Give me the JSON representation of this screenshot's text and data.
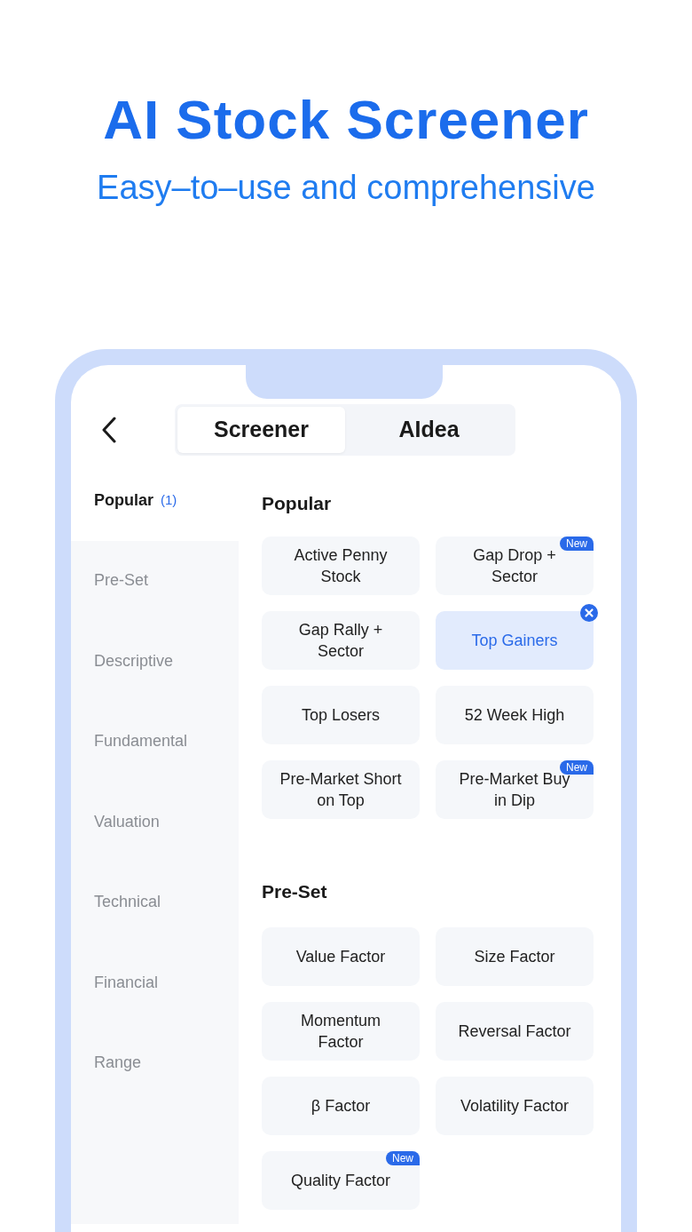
{
  "headline": {
    "title": "AI Stock Screener",
    "subtitle": "Easy–to–use and comprehensive"
  },
  "tabs": [
    {
      "label": "Screener",
      "selected": true
    },
    {
      "label": "AIdea",
      "selected": false
    }
  ],
  "sidebar": {
    "items": [
      {
        "label": "Popular",
        "count": "(1)",
        "selected": true
      },
      {
        "label": "Pre-Set",
        "selected": false
      },
      {
        "label": "Descriptive",
        "selected": false
      },
      {
        "label": "Fundamental",
        "selected": false
      },
      {
        "label": "Valuation",
        "selected": false
      },
      {
        "label": "Technical",
        "selected": false
      },
      {
        "label": "Financial",
        "selected": false
      },
      {
        "label": "Range",
        "selected": false
      }
    ]
  },
  "sections": [
    {
      "title": "Popular",
      "tiles": [
        {
          "label": "Active Penny\nStock",
          "selected": false
        },
        {
          "label": "Gap Drop +\nSector",
          "selected": false,
          "badge": "New"
        },
        {
          "label": "Gap Rally +\nSector",
          "selected": false
        },
        {
          "label": "Top Gainers",
          "selected": true
        },
        {
          "label": "Top Losers",
          "selected": false
        },
        {
          "label": "52 Week High",
          "selected": false
        },
        {
          "label": "Pre-Market Short\non Top",
          "selected": false
        },
        {
          "label": "Pre-Market Buy\nin Dip",
          "selected": false,
          "badge": "New"
        }
      ]
    },
    {
      "title": "Pre-Set",
      "tiles": [
        {
          "label": "Value Factor",
          "selected": false
        },
        {
          "label": "Size Factor",
          "selected": false
        },
        {
          "label": "Momentum\nFactor",
          "selected": false
        },
        {
          "label": "Reversal Factor",
          "selected": false
        },
        {
          "label": "β Factor",
          "selected": false
        },
        {
          "label": "Volatility Factor",
          "selected": false
        },
        {
          "label": "Quality Factor",
          "selected": false,
          "badge": "New"
        }
      ]
    }
  ]
}
